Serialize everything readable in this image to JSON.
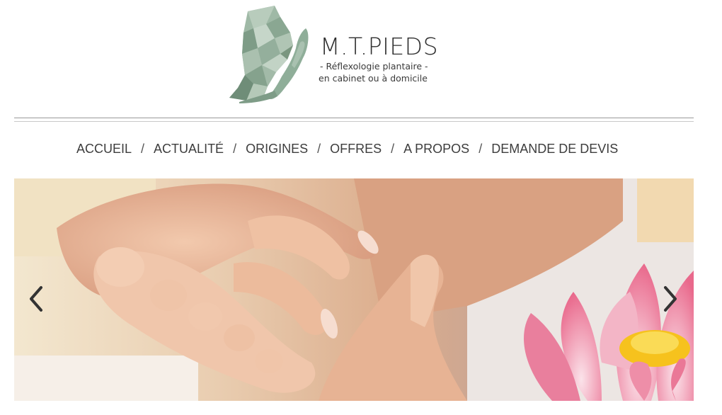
{
  "brand": {
    "name": "M.T.PIEDS",
    "tagline_1": "- Réflexologie plantaire -",
    "tagline_2": "en cabinet ou à domicile"
  },
  "nav": {
    "items": [
      {
        "label": "ACCUEIL"
      },
      {
        "label": "ACTUALITÉ"
      },
      {
        "label": "ORIGINES"
      },
      {
        "label": "OFFRES"
      },
      {
        "label": "A PROPOS"
      },
      {
        "label": "DEMANDE DE DEVIS"
      }
    ],
    "separator": "/"
  },
  "slider": {
    "image": "foot-massage-photo",
    "prev_icon": "chevron-left-icon",
    "next_icon": "chevron-right-icon"
  },
  "colors": {
    "logo_green": "#8fae99",
    "text": "#3d3d3d",
    "divider": "#9a9a9a"
  }
}
